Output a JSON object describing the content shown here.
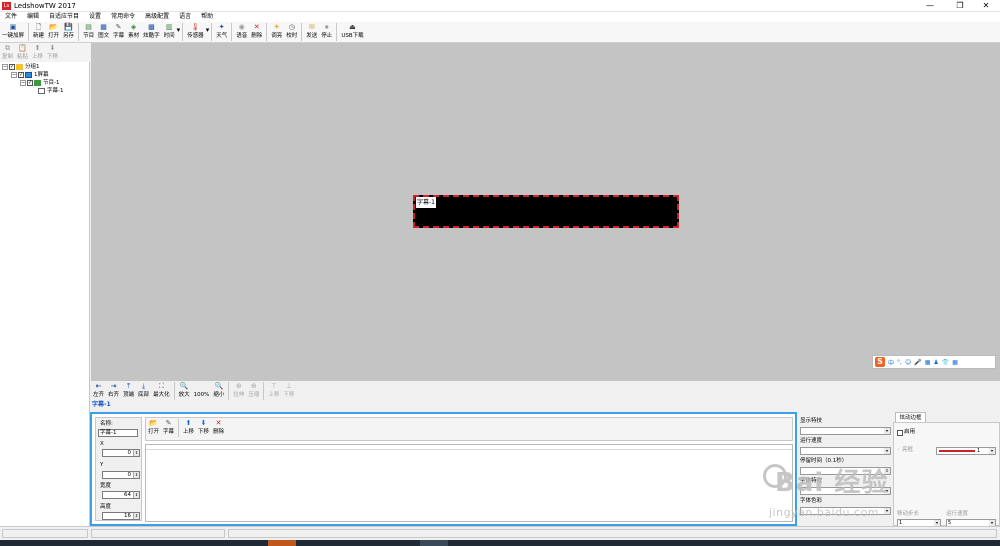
{
  "window": {
    "title": "LedshowTW 2017",
    "logo_text": "Ls",
    "controls": [
      "—",
      "❐",
      "✕"
    ]
  },
  "menu": [
    "文件",
    "编辑",
    "自适应节目",
    "设置",
    "常用命令",
    "高级配置",
    "语言",
    "帮助"
  ],
  "toolbar": [
    {
      "label": "一键加屏",
      "icon": "add-screen-icon",
      "glyph": "▣",
      "color": "#1a4fa0"
    },
    {
      "label": "新建",
      "icon": "new-file-icon",
      "glyph": "🗋",
      "color": "#333333"
    },
    {
      "label": "打开",
      "icon": "open-folder-icon",
      "glyph": "📂",
      "color": "#c99a1a"
    },
    {
      "label": "另存",
      "icon": "save-as-icon",
      "glyph": "💾",
      "color": "#1a4fa0"
    },
    {
      "label": "节目",
      "icon": "program-icon",
      "glyph": "▤",
      "color": "#2e7d32"
    },
    {
      "label": "图文",
      "icon": "image-text-icon",
      "glyph": "▦",
      "color": "#1a4fa0"
    },
    {
      "label": "字幕",
      "icon": "subtitle-icon",
      "glyph": "✎",
      "color": "#555555"
    },
    {
      "label": "素材",
      "icon": "material-icon",
      "glyph": "◈",
      "color": "#2e7d32"
    },
    {
      "label": "炫酷字",
      "icon": "cool-text-icon",
      "glyph": "▩",
      "color": "#1a4fa0"
    },
    {
      "label": "时间",
      "icon": "time-icon",
      "glyph": "▥",
      "color": "#2e7d32"
    },
    {
      "label": "传感器",
      "icon": "sensor-icon",
      "glyph": "🌡",
      "color": "#c0392b"
    },
    {
      "label": "天气",
      "icon": "weather-icon",
      "glyph": "✦",
      "color": "#1a4fa0"
    },
    {
      "label": "语音",
      "icon": "voice-icon",
      "glyph": "◉",
      "color": "#9a9a9a"
    },
    {
      "label": "删除",
      "icon": "delete-icon",
      "glyph": "✕",
      "color": "#d0202a"
    },
    {
      "label": "调亮",
      "icon": "brightness-icon",
      "glyph": "☀",
      "color": "#c9a11a"
    },
    {
      "label": "校时",
      "icon": "clock-sync-icon",
      "glyph": "◷",
      "color": "#555555"
    },
    {
      "label": "发送",
      "icon": "send-icon",
      "glyph": "✉",
      "color": "#c99a1a"
    },
    {
      "label": "停止",
      "icon": "stop-icon",
      "glyph": "⏹",
      "color": "#9a9a9a"
    },
    {
      "label": "USB下载",
      "icon": "usb-download-icon",
      "glyph": "⏏",
      "color": "#333333"
    }
  ],
  "left_toolbar": [
    "复制",
    "粘贴",
    "上移",
    "下移"
  ],
  "tree": [
    {
      "label": "分组1",
      "level": 0,
      "icon": "folder-icon"
    },
    {
      "label": "1屏幕",
      "level": 1,
      "icon": "screen-icon"
    },
    {
      "label": "节目-1",
      "level": 2,
      "icon": "program-icon"
    },
    {
      "label": "字幕-1",
      "level": 3,
      "icon": "subtitle-icon"
    }
  ],
  "canvas": {
    "led_caption": "字幕-1",
    "ime_bar": [
      "中",
      "°,",
      "☺",
      "🎤",
      "▦",
      "♟",
      "👕",
      "▦"
    ]
  },
  "zoom_toolbar": [
    {
      "label": "左齐",
      "glyph": "⇤",
      "enabled": true
    },
    {
      "label": "右齐",
      "glyph": "⇥",
      "enabled": true
    },
    {
      "label": "顶端",
      "glyph": "⤒",
      "enabled": true
    },
    {
      "label": "底部",
      "glyph": "⤓",
      "enabled": true
    },
    {
      "label": "最大化",
      "glyph": "⛶",
      "enabled": true
    },
    {
      "label": "放大",
      "glyph": "🔍",
      "enabled": true
    },
    {
      "label": "100%",
      "glyph": "",
      "enabled": true
    },
    {
      "label": "缩小",
      "glyph": "🔍",
      "enabled": true
    },
    {
      "label": "拉伸",
      "glyph": "⊕",
      "enabled": false
    },
    {
      "label": "压缩",
      "glyph": "⊕",
      "enabled": false
    },
    {
      "label": "上移",
      "glyph": "⊤",
      "enabled": false
    },
    {
      "label": "下移",
      "glyph": "⊥",
      "enabled": false
    }
  ],
  "current_item": "字幕-1",
  "properties": {
    "name_label": "名称:",
    "name_value": "字幕-1",
    "x_label": "X",
    "x_value": "0",
    "y_label": "Y",
    "y_value": "0",
    "width_label": "宽度",
    "width_value": "64",
    "height_label": "高度",
    "height_value": "16"
  },
  "edit_toolbar": [
    "打开",
    "字幕",
    "上移",
    "下移",
    "删除"
  ],
  "effect": {
    "display_effect_label": "显示特技",
    "run_speed_label": "运行速度",
    "stay_time_label": "停留时间（0.1秒）",
    "font_effect_label": "字体特效",
    "font_color_label": "字体色彩",
    "border_tab": "炫动边框",
    "enable_label": "启用",
    "mode_label": "亮框",
    "move_step_label": "移动步长",
    "run_speed2_label": "运行速度",
    "border_count": "1",
    "step_value": "1",
    "speed_value": "5"
  },
  "watermark": {
    "text": "Bai 经验",
    "url": "jingyan.baidu.com"
  }
}
